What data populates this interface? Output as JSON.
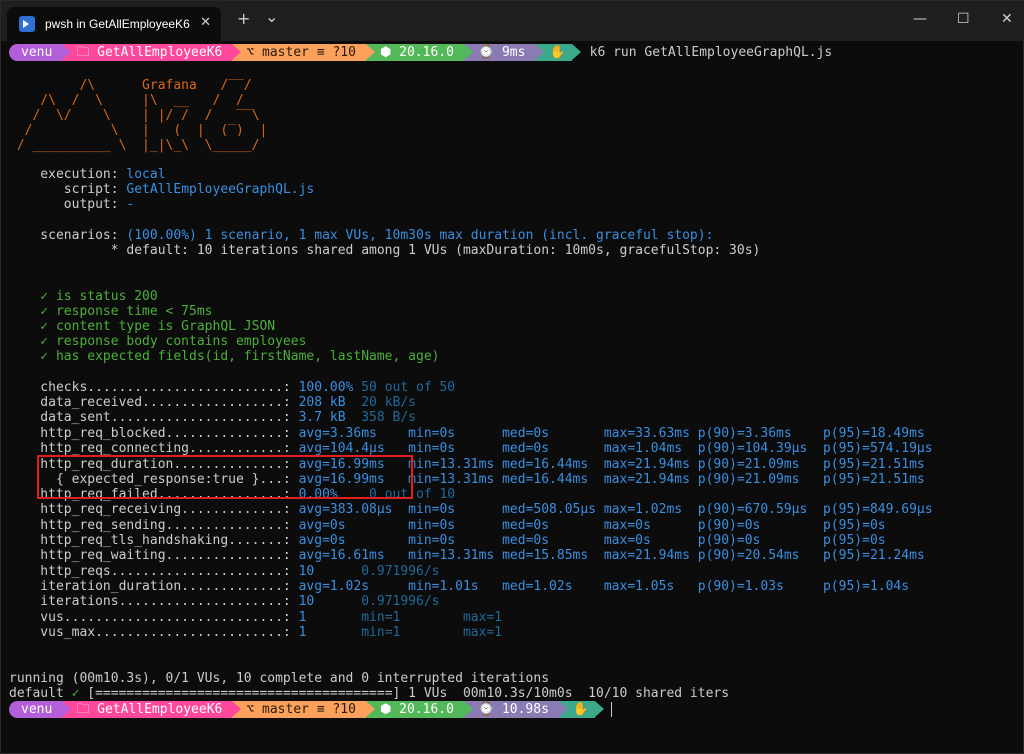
{
  "window": {
    "tab_title": "pwsh in GetAllEmployeeK6",
    "tab_close": "✕",
    "new_tab": "+",
    "dropdown": "⌄",
    "minimize": "—",
    "maximize": "☐",
    "close": "✕"
  },
  "prompt": {
    "user": "venu",
    "folder": "GetAllEmployeeK6",
    "git": "master ≡ ?10",
    "node": "20.16.0",
    "time1": "9ms",
    "time2": "10.98s",
    "command": "k6 run GetAllEmployeeGraphQL.js"
  },
  "banner": [
    "         /\\      Grafana   /‾‾/",
    "    /\\  /  \\     |\\  __   /  /",
    "   /  \\/    \\    | |/ /  /   ‾‾\\",
    "  /          \\   |   (  |  (‾)  |",
    " / __________ \\  |_|\\_\\  \\_____/"
  ],
  "info": {
    "execution_label": "    execution: ",
    "execution_value": "local",
    "script_label": "       script: ",
    "script_value": "GetAllEmployeeGraphQL.js",
    "output_label": "       output: ",
    "output_value": "-",
    "scenarios_label": "    scenarios: ",
    "scenarios_value": "(100.00%) 1 scenario, 1 max VUs, 10m30s max duration (incl. graceful stop):",
    "default_line": "             * default: 10 iterations shared among 1 VUs (maxDuration: 10m0s, gracefulStop: 30s)"
  },
  "checks": [
    "    ✓ is status 200",
    "    ✓ response time < 75ms",
    "    ✓ content type is GraphQL JSON",
    "    ✓ response body contains employees",
    "    ✓ has expected fields(id, firstName, lastName, age)"
  ],
  "metrics": [
    {
      "name": "    checks.........................: ",
      "a": "100.00%",
      "b": " 50 out of 50",
      "rest": ""
    },
    {
      "name": "    data_received..................: ",
      "a": "208 kB",
      "b": "  20 kB/s",
      "rest": ""
    },
    {
      "name": "    data_sent......................: ",
      "a": "3.7 kB",
      "b": "  358 B/s",
      "rest": ""
    },
    {
      "name": "    http_req_blocked...............: ",
      "a": "",
      "b": "",
      "rest": "avg=3.36ms    min=0s      med=0s       max=33.63ms p(90)=3.36ms    p(95)=18.49ms"
    },
    {
      "name": "    http_req_connecting............: ",
      "a": "",
      "b": "",
      "rest": "avg=104.4µs   min=0s      med=0s       max=1.04ms  p(90)=104.39µs  p(95)=574.19µs"
    },
    {
      "name": "    http_req_duration..............: ",
      "a": "",
      "b": "",
      "rest": "avg=16.99ms   min=13.31ms med=16.44ms  max=21.94ms p(90)=21.09ms   p(95)=21.51ms"
    },
    {
      "name": "      { expected_response:true }...: ",
      "a": "",
      "b": "",
      "rest": "avg=16.99ms   min=13.31ms med=16.44ms  max=21.94ms p(90)=21.09ms   p(95)=21.51ms"
    },
    {
      "name": "    http_req_failed................: ",
      "a": "0.00%",
      "b": "    0 out of 10",
      "rest": ""
    },
    {
      "name": "    http_req_receiving.............: ",
      "a": "",
      "b": "",
      "rest": "avg=383.08µs  min=0s      med=508.05µs max=1.02ms  p(90)=670.59µs  p(95)=849.69µs"
    },
    {
      "name": "    http_req_sending...............: ",
      "a": "",
      "b": "",
      "rest": "avg=0s        min=0s      med=0s       max=0s      p(90)=0s        p(95)=0s"
    },
    {
      "name": "    http_req_tls_handshaking.......: ",
      "a": "",
      "b": "",
      "rest": "avg=0s        min=0s      med=0s       max=0s      p(90)=0s        p(95)=0s"
    },
    {
      "name": "    http_req_waiting...............: ",
      "a": "",
      "b": "",
      "rest": "avg=16.61ms   min=13.31ms med=15.85ms  max=21.94ms p(90)=20.54ms   p(95)=21.24ms"
    },
    {
      "name": "    http_reqs......................: ",
      "a": "10",
      "b": "      0.971996/s",
      "rest": ""
    },
    {
      "name": "    iteration_duration.............: ",
      "a": "",
      "b": "",
      "rest": "avg=1.02s     min=1.01s   med=1.02s    max=1.05s   p(90)=1.03s     p(95)=1.04s"
    },
    {
      "name": "    iterations.....................: ",
      "a": "10",
      "b": "      0.971996/s",
      "rest": ""
    },
    {
      "name": "    vus............................: ",
      "a": "1",
      "b": "       min=1        max=1",
      "rest": ""
    },
    {
      "name": "    vus_max........................: ",
      "a": "1",
      "b": "       min=1        max=1",
      "rest": ""
    }
  ],
  "status": {
    "running": "running (00m10.3s), 0/1 VUs, 10 complete and 0 interrupted iterations",
    "default_prefix": "default ",
    "default_check": "✓",
    "default_rest": " [======================================] 1 VUs  00m10.3s/10m0s  10/10 shared iters"
  }
}
